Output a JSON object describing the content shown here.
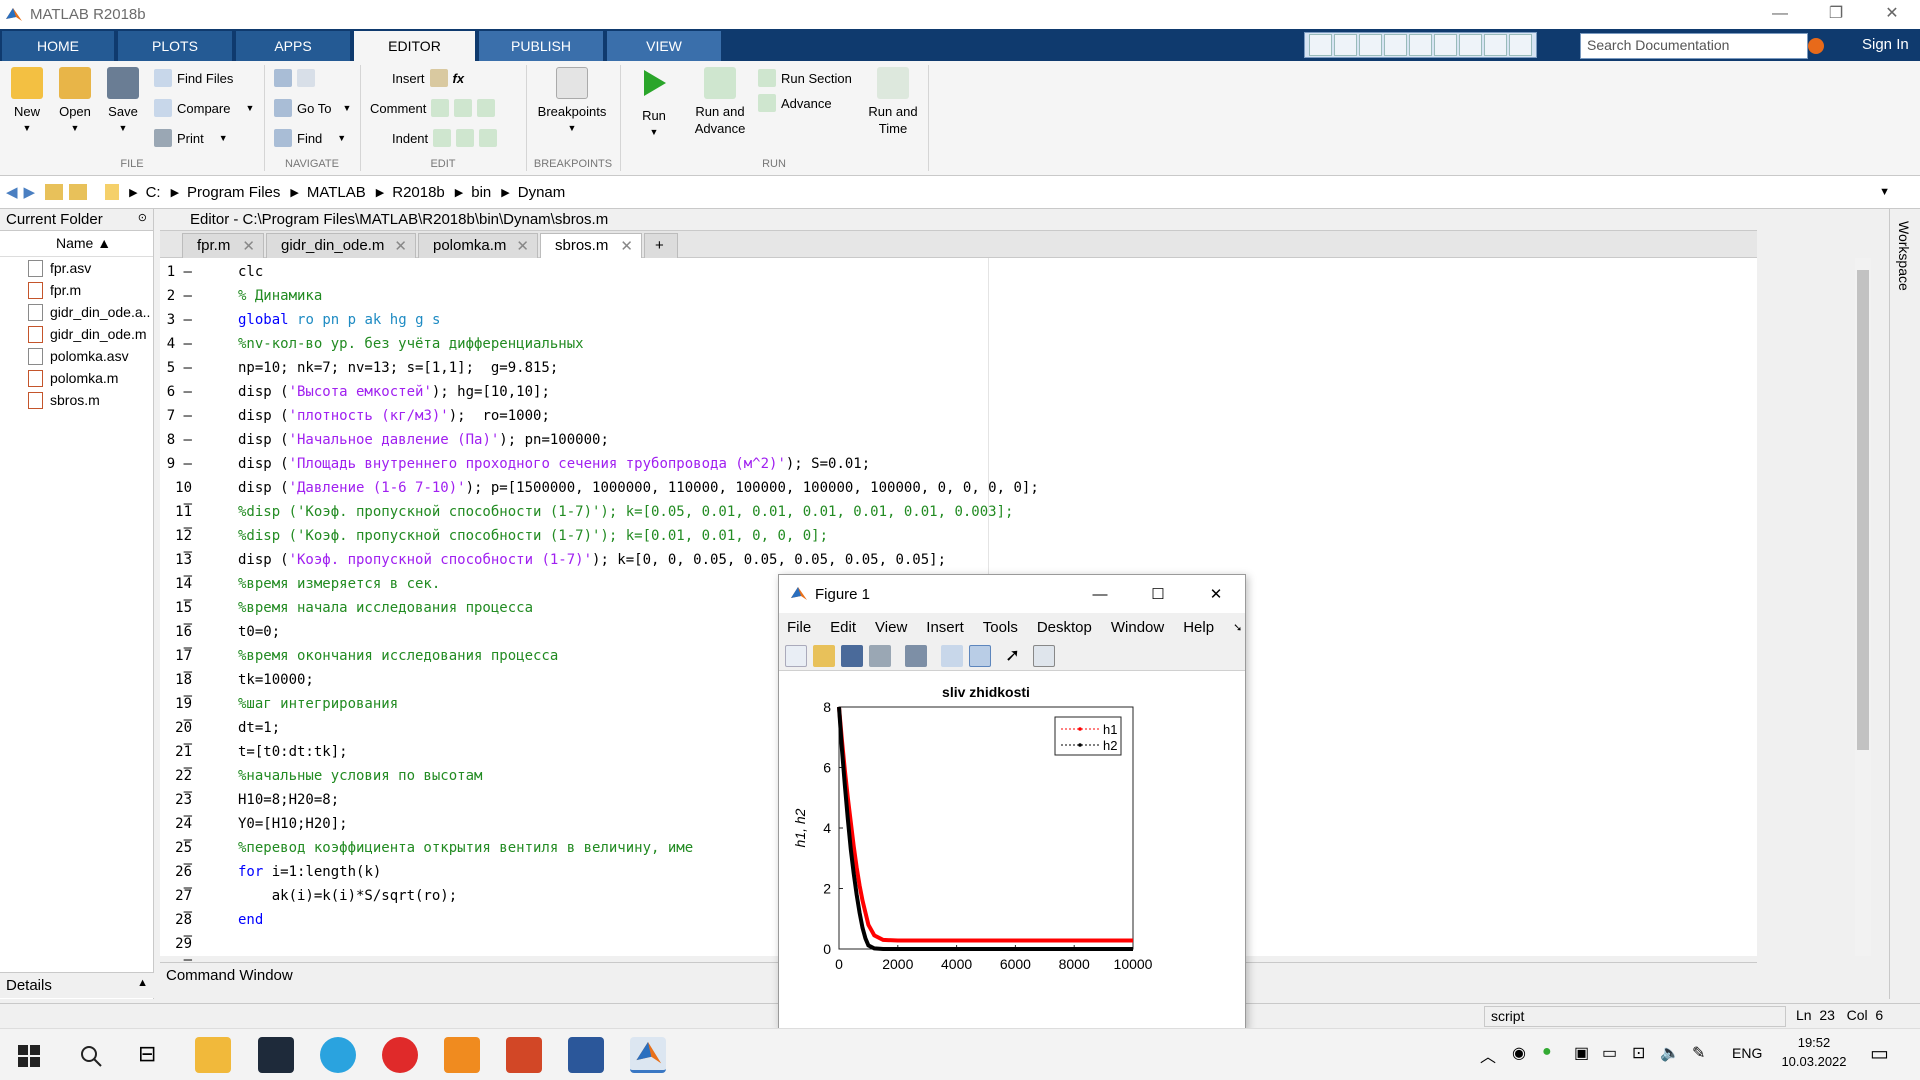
{
  "window": {
    "title": "MATLAB R2018b"
  },
  "tabs": [
    "HOME",
    "PLOTS",
    "APPS",
    "EDITOR",
    "PUBLISH",
    "VIEW"
  ],
  "search": {
    "placeholder": "Search Documentation"
  },
  "signin": "Sign In",
  "ribbon": {
    "new": "New",
    "open": "Open",
    "save": "Save",
    "find_files": "Find Files",
    "compare": "Compare",
    "print": "Print",
    "goto": "Go To",
    "find": "Find",
    "insert": "Insert",
    "comment": "Comment",
    "indent": "Indent",
    "breakpoints": "Breakpoints",
    "run": "Run",
    "run_advance_1": "Run and",
    "run_advance_2": "Advance",
    "run_section": "Run Section",
    "advance": "Advance",
    "run_time_1": "Run and",
    "run_time_2": "Time",
    "groups": [
      "FILE",
      "NAVIGATE",
      "EDIT",
      "BREAKPOINTS",
      "RUN"
    ]
  },
  "address": [
    "C:",
    "Program Files",
    "MATLAB",
    "R2018b",
    "bin",
    "Dynam"
  ],
  "current_folder": {
    "title": "Current Folder",
    "name_col": "Name ▲",
    "files": [
      "fpr.asv",
      "fpr.m",
      "gidr_din_ode.a..",
      "gidr_din_ode.m",
      "polomka.asv",
      "polomka.m",
      "sbros.m"
    ]
  },
  "details": "Details",
  "editor": {
    "header": "Editor - C:\\Program Files\\MATLAB\\R2018b\\bin\\Dynam\\sbros.m",
    "tabs": [
      "fpr.m",
      "gidr_din_ode.m",
      "polomka.m",
      "sbros.m"
    ],
    "lines": [
      "clc",
      "% Динамика",
      "global ro pn p ak hg g s",
      "%nv-кол-во ур. без учёта дифференциальных",
      "np=10; nk=7; nv=13; s=[1,1];  g=9.815;",
      "disp ('Высота емкостей'); hg=[10,10];",
      "disp ('плотность (кг/м3)');  ro=1000;",
      "disp ('Начальное давление (Па)'); pn=100000;",
      "disp ('Площадь внутреннего проходного сечения трубопровода (м^2)'); S=0.01;",
      "disp ('Давление (1-6 7-10)'); p=[1500000, 1000000, 110000, 100000, 100000, 100000, 0, 0, 0, 0];",
      "%disp ('Коэф. пропускной способности (1-7)'); k=[0.05, 0.01, 0.01, 0.01, 0.01, 0.01, 0.003];",
      "%disp ('Коэф. пропускной способности (1-7)'); k=[0.01, 0.01, 0, 0, 0];",
      "disp ('Коэф. пропускной способности (1-7)'); k=[0, 0, 0.05, 0.05, 0.05, 0.05, 0.05];",
      "%время измеряется в сек.",
      "%время начала исследования процесса",
      "t0=0;",
      "%время окончания исследования процесса",
      "tk=10000;",
      "%шаг интегрирования",
      "dt=1;",
      "t=[t0:dt:tk];",
      "%начальные условия по высотам",
      "H10=8;H20=8;",
      "Y0=[H10;H20];",
      "%перевод коэффициента открытия вентиля в величину, име",
      "for i=1:length(k)",
      "    ak(i)=k(i)*S/sqrt(ro);",
      "end",
      ""
    ]
  },
  "command_window": "Command Window",
  "workspace": "Workspace",
  "status": {
    "mode": "script",
    "ln": "Ln",
    "ln_val": "23",
    "col": "Col",
    "col_val": "6"
  },
  "figure": {
    "title": "Figure 1",
    "menu": [
      "File",
      "Edit",
      "View",
      "Insert",
      "Tools",
      "Desktop",
      "Window",
      "Help"
    ]
  },
  "chart_data": {
    "type": "line",
    "title": "sliv zhidkosti",
    "xlabel": "",
    "ylabel": "h1, h2",
    "xlim": [
      0,
      10000
    ],
    "ylim": [
      0,
      8
    ],
    "xticks": [
      "0",
      "2000",
      "4000",
      "6000",
      "8000",
      "10000"
    ],
    "yticks": [
      "0",
      "2",
      "4",
      "6",
      "8"
    ],
    "legend_position": "top-right",
    "series": [
      {
        "name": "h1",
        "color": "#ff0000",
        "x": [
          0,
          100,
          200,
          300,
          400,
          500,
          600,
          700,
          800,
          900,
          1000,
          1200,
          1500,
          2000,
          10000
        ],
        "y": [
          8,
          6.9,
          5.9,
          5.0,
          4.2,
          3.4,
          2.7,
          2.1,
          1.6,
          1.2,
          0.8,
          0.45,
          0.3,
          0.28,
          0.28
        ]
      },
      {
        "name": "h2",
        "color": "#000000",
        "x": [
          0,
          100,
          200,
          300,
          400,
          500,
          600,
          700,
          800,
          900,
          1000,
          1200,
          1500,
          10000
        ],
        "y": [
          8,
          6.6,
          5.4,
          4.3,
          3.3,
          2.5,
          1.8,
          1.2,
          0.7,
          0.35,
          0.12,
          0.02,
          0.0,
          0.0
        ]
      }
    ]
  },
  "clock": {
    "time": "19:52",
    "date": "10.03.2022"
  },
  "lang": "ENG"
}
